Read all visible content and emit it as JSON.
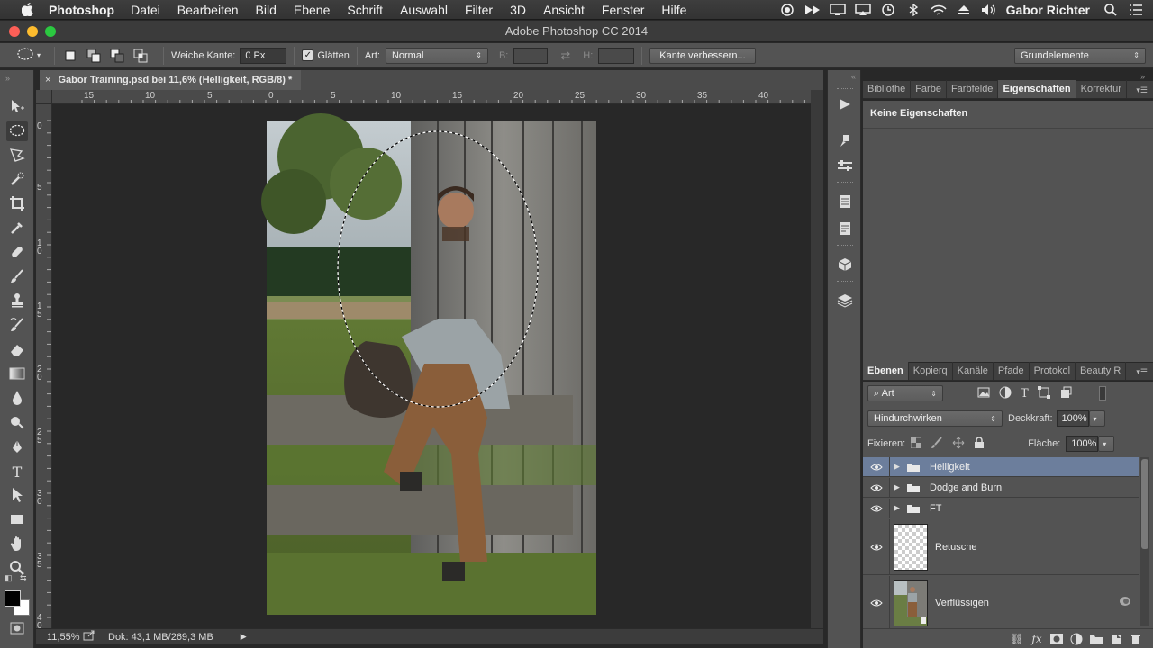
{
  "menubar": {
    "app_name": "Photoshop",
    "items": [
      "Datei",
      "Bearbeiten",
      "Bild",
      "Ebene",
      "Schrift",
      "Auswahl",
      "Filter",
      "3D",
      "Ansicht",
      "Fenster",
      "Hilfe"
    ],
    "user": "Gabor Richter"
  },
  "window": {
    "title": "Adobe Photoshop CC 2014"
  },
  "options": {
    "feather_label": "Weiche Kante:",
    "feather_value": "0 Px",
    "antialias_label": "Glätten",
    "style_label": "Art:",
    "style_value": "Normal",
    "width_label": "B:",
    "height_label": "H:",
    "refine_edge_button": "Kante verbessern...",
    "workspace": "Grundelemente"
  },
  "document": {
    "tab_title": "Gabor Training.psd bei 11,6% (Helligkeit, RGB/8) *",
    "ruler_top": [
      "15",
      "10",
      "5",
      "0",
      "5",
      "10",
      "15",
      "20",
      "25",
      "30",
      "35",
      "40"
    ],
    "ruler_left": [
      "0",
      "5",
      "1 0",
      "1 5",
      "2 0",
      "2 5",
      "3 0",
      "3 5",
      "4 0"
    ]
  },
  "status": {
    "zoom": "11,55%",
    "doc_info": "Dok: 43,1 MB/269,3 MB"
  },
  "properties_panel": {
    "tabs": [
      "Bibliothe",
      "Farbe",
      "Farbfelde",
      "Eigenschaften",
      "Korrektur"
    ],
    "active_tab": 3,
    "title": "Keine Eigenschaften"
  },
  "layers_panel": {
    "tabs": [
      "Ebenen",
      "Kopierq",
      "Kanäle",
      "Pfade",
      "Protokol",
      "Beauty R"
    ],
    "active_tab": 0,
    "filter_kind": "Art",
    "blend_mode": "Hindurchwirken",
    "opacity_label": "Deckkraft:",
    "opacity_value": "100%",
    "lock_label": "Fixieren:",
    "fill_label": "Fläche:",
    "fill_value": "100%",
    "layers": [
      {
        "name": "Helligkeit",
        "type": "group",
        "selected": true
      },
      {
        "name": "Dodge and Burn",
        "type": "group",
        "selected": false
      },
      {
        "name": "FT",
        "type": "group",
        "selected": false
      },
      {
        "name": "Retusche",
        "type": "pixel",
        "selected": false
      },
      {
        "name": "Verflüssigen",
        "type": "smart",
        "selected": false
      }
    ]
  },
  "colors": {
    "selected_layer": "#6c7e9c",
    "foreground": "#000000",
    "background": "#ffffff"
  }
}
